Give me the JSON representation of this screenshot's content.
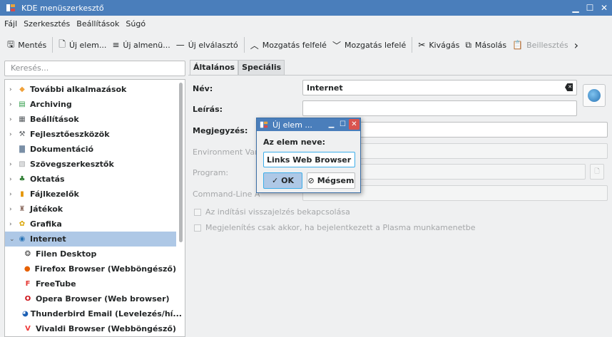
{
  "window": {
    "title": "KDE menüszerkesztő",
    "minimize": "▁",
    "maximize": "☐",
    "close": "✕"
  },
  "menubar": [
    "Fájl",
    "Szerkesztés",
    "Beállítások",
    "Súgó"
  ],
  "toolbar": {
    "save": "Mentés",
    "new_item": "Új elem...",
    "new_submenu": "Új almenü...",
    "new_separator": "Új elválasztó",
    "move_up": "Mozgatás felfelé",
    "move_down": "Mozgatás lefelé",
    "cut": "Kivágás",
    "copy": "Másolás",
    "paste": "Beillesztés",
    "more": "›"
  },
  "search": {
    "placeholder": "Keresés..."
  },
  "tree": [
    {
      "label": "További alkalmazások",
      "icon": "apps-icon",
      "color": "#f0a13a"
    },
    {
      "label": "Archiving",
      "icon": "archive-icon",
      "color": "#2e9b47"
    },
    {
      "label": "Beállítások",
      "icon": "settings-icon",
      "color": "#5a5f63"
    },
    {
      "label": "Fejlesztőeszközök",
      "icon": "tools-icon",
      "color": "#5a5f63"
    },
    {
      "label": "Dokumentáció",
      "icon": "book-icon",
      "color": "#7a8fa6"
    },
    {
      "label": "Szövegszerkesztők",
      "icon": "editor-icon",
      "color": "#a3a6a8"
    },
    {
      "label": "Oktatás",
      "icon": "education-icon",
      "color": "#2e7d32"
    },
    {
      "label": "Fájlkezelők",
      "icon": "folder-icon",
      "color": "#e59400"
    },
    {
      "label": "Játékok",
      "icon": "games-icon",
      "color": "#8d6e63"
    },
    {
      "label": "Grafika",
      "icon": "graphics-icon",
      "color": "#f6c343"
    },
    {
      "label": "Internet",
      "icon": "globe-icon",
      "color": "#2a74b5"
    },
    {
      "label": "Filen Desktop",
      "icon": "filen-icon",
      "color": "#444"
    },
    {
      "label": "Firefox Browser (Webböngésző)",
      "icon": "firefox-icon",
      "color": "#e66000"
    },
    {
      "label": "FreeTube",
      "icon": "freetube-icon",
      "color": "#e53935"
    },
    {
      "label": "Opera Browser (Web browser)",
      "icon": "opera-icon",
      "color": "#cc0f16"
    },
    {
      "label": "Thunderbird Email (Levelezés/hí...",
      "icon": "thunderbird-icon",
      "color": "#1a5fb4"
    },
    {
      "label": "Vivaldi Browser (Webböngésző)",
      "icon": "vivaldi-icon",
      "color": "#ef3939"
    }
  ],
  "tabs": [
    "Általános",
    "Speciális"
  ],
  "form": {
    "name_label": "Név:",
    "name_value": "Internet",
    "desc_label": "Leírás:",
    "comment_label": "Megjegyzés:",
    "env_label": "Environment Var",
    "program_label": "Program:",
    "cmdline_label": "Command-Line A",
    "startup_feedback": "Az indítási visszajelzés bekapcsolása",
    "plasma_only": "Megjelenítés csak akkor, ha bejelentkezett a Plasma munkamenetbe"
  },
  "dialog": {
    "title": "Új elem ...",
    "label": "Az elem neve:",
    "value": "Links Web Browser",
    "ok": "OK",
    "cancel": "Mégsem"
  }
}
